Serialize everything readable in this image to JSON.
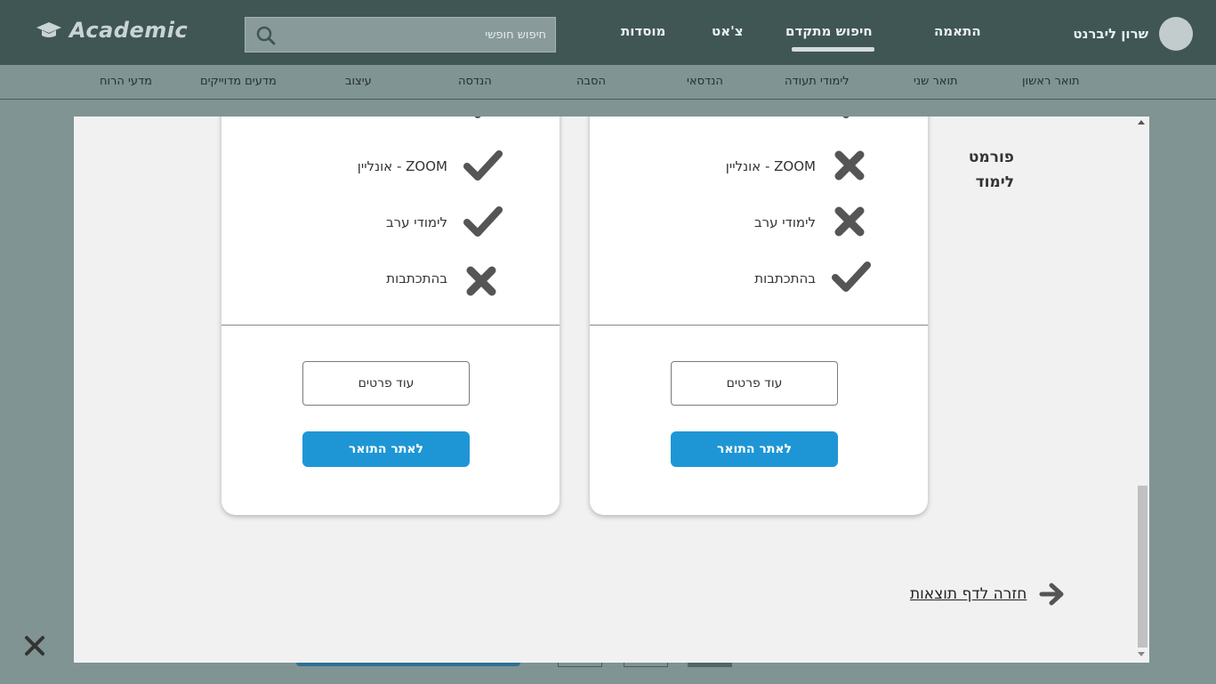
{
  "header": {
    "logo_text": "Academic",
    "search_placeholder": "חיפוש חופשי",
    "nav": {
      "institutions": "מוסדות",
      "chat": "צ'אט",
      "advanced_search": "חיפוש מתקדם",
      "match": "התאמה"
    },
    "user_name": "שרון ליברנט"
  },
  "categories": {
    "bachelor": "תואר ראשון",
    "master": "תואר שני",
    "certificate": "לימודי תעודה",
    "practical_engineer": "הנדסאי",
    "retraining": "הסבה",
    "engineering": "הנדסה",
    "design": "עיצוב",
    "exact_sciences": "מדעים מדוייקים",
    "humanities": "מדעי הרוח"
  },
  "comparison": {
    "row_label": "פורמט\nלימוד",
    "features": {
      "zoom": "ZOOM - אונליין",
      "evening": "לימודי ערב",
      "correspondence": "בהתכתבות"
    },
    "cards": [
      {
        "zoom": "check",
        "evening": "check",
        "correspondence": "cross"
      },
      {
        "zoom": "cross",
        "evening": "cross",
        "correspondence": "check"
      }
    ],
    "more_details_label": "עוד פרטים",
    "degree_site_label": "לאתר התואר",
    "back_link": "חזרה לדף תוצאות"
  },
  "colors": {
    "header_bg": "#3f5655",
    "primary_button": "#1e96d6",
    "icon_gray": "#555555"
  }
}
